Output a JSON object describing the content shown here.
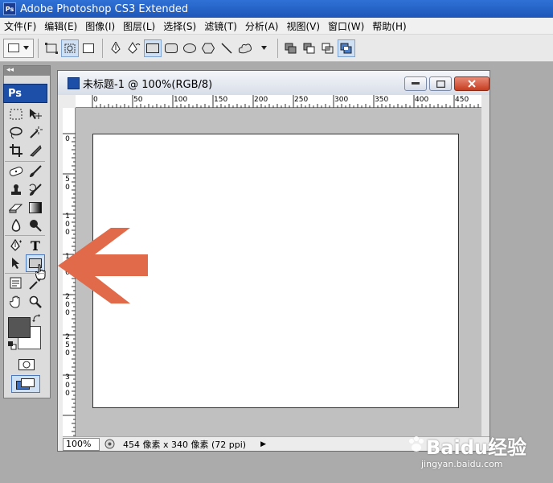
{
  "app": {
    "logo": "Ps",
    "title": "Adobe Photoshop CS3 Extended"
  },
  "menu": [
    "文件(F)",
    "编辑(E)",
    "图像(I)",
    "图层(L)",
    "选择(S)",
    "滤镜(T)",
    "分析(A)",
    "视图(V)",
    "窗口(W)",
    "帮助(H)"
  ],
  "toolbox": {
    "logo": "Ps",
    "header_glyph": "◂◂",
    "type_tool_glyph": "T",
    "active_tool": "rectangle-tool"
  },
  "document": {
    "title": "未标题-1 @ 100%(RGB/8)",
    "ruler_h": [
      "0",
      "50",
      "100",
      "150",
      "200",
      "250",
      "300",
      "350",
      "400",
      "450"
    ],
    "ruler_v": [
      "5\n0",
      "1\n0\n0",
      "1\n5\n0",
      "2\n0\n0",
      "2\n5\n0",
      "3\n0\n0"
    ],
    "ruler_v_top": "0",
    "zoom": "100%",
    "status": "454 像素 x 340 像素 (72 ppi)",
    "status_arrow": "▶"
  },
  "watermark": {
    "brand": "Baidu经验",
    "url": "jingyan.baidu.com"
  },
  "colors": {
    "titlebar": "#1e56b8",
    "arrow": "#e06a4a",
    "foreground": "#555555",
    "background": "#ffffff"
  }
}
